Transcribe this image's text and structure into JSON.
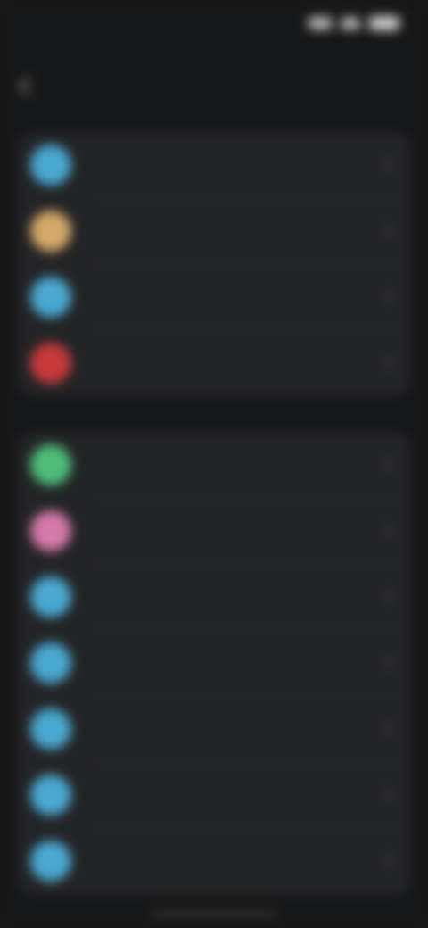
{
  "status_bar": {
    "time": ""
  },
  "nav": {
    "back_label": "",
    "title": ""
  },
  "groups": [
    {
      "rows": [
        {
          "label": "",
          "icon": "settings-icon",
          "color": "#4aa8d0"
        },
        {
          "label": "",
          "icon": "app-icon",
          "color": "#d4a96a"
        },
        {
          "label": "",
          "icon": "settings-icon",
          "color": "#4aa8d0"
        },
        {
          "label": "",
          "icon": "app-icon",
          "color": "#c8393a"
        }
      ]
    },
    {
      "rows": [
        {
          "label": "",
          "icon": "app-icon",
          "color": "#4fbe79"
        },
        {
          "label": "",
          "icon": "app-icon",
          "color": "#d47aa8"
        },
        {
          "label": "",
          "icon": "settings-icon",
          "color": "#4aa8d0"
        },
        {
          "label": "",
          "icon": "settings-icon",
          "color": "#4aa8d0"
        },
        {
          "label": "",
          "icon": "settings-icon",
          "color": "#4aa8d0"
        },
        {
          "label": "",
          "icon": "settings-icon",
          "color": "#4aa8d0"
        },
        {
          "label": "",
          "icon": "settings-icon",
          "color": "#4aa8d0"
        }
      ]
    }
  ],
  "colors": {
    "background": "#161718",
    "group_background": "#232426",
    "text": "#bcbcbc"
  }
}
